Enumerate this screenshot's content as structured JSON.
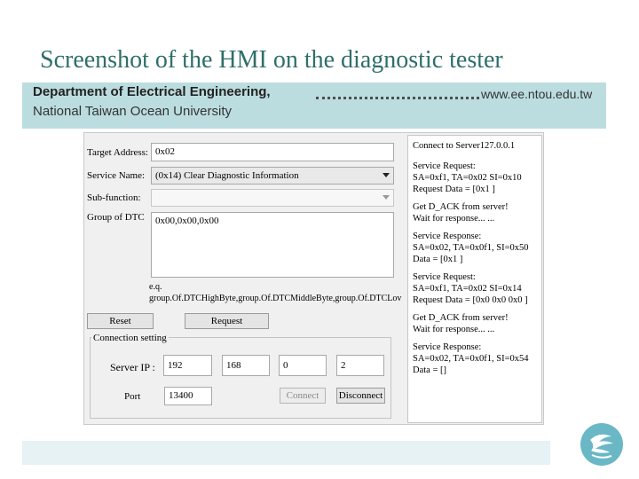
{
  "slide": {
    "title": "Screenshot of the HMI on the diagnostic tester",
    "department": "Department of Electrical Engineering,",
    "url": "www.ee.ntou.edu.tw",
    "university": "National Taiwan Ocean University"
  },
  "form": {
    "target_address_label": "Target Address:",
    "target_address_value": "0x02",
    "service_name_label": "Service Name:",
    "service_name_value": "(0x14) Clear Diagnostic Information",
    "sub_function_label": "Sub-function:",
    "sub_function_value": "",
    "group_of_dtc_label": "Group of DTC",
    "group_of_dtc_value": "0x00,0x00,0x00",
    "hint_line1": "e.q.",
    "hint_line2": "group.Of.DTCHighByte,group.Of.DTCMiddleByte,group.Of.DTCLov",
    "reset_label": "Reset",
    "request_label": "Request"
  },
  "connection": {
    "group_label": "Connection setting",
    "server_ip_label": "Server IP :",
    "ip_octets": [
      "192",
      "168",
      "0",
      "2"
    ],
    "port_label": "Port",
    "port_value": "13400",
    "connect_label": "Connect",
    "disconnect_label": "Disconnect"
  },
  "log": [
    [
      "Connect to Server127.0.0.1"
    ],
    [
      "Service Request:",
      "SA=0xf1,  TA=0x02 SI=0x10",
      "Request Data = [0x1 ]"
    ],
    [
      "Get D_ACK from server!",
      "Wait for response... ..."
    ],
    [
      "Service Response:",
      "SA=0x02,  TA=0x0f1, SI=0x50",
      "Data = [0x1 ]"
    ],
    [
      "Service Request:",
      "SA=0xf1,  TA=0x02 SI=0x14",
      "Request Data = [0x0 0x0 0x0 ]"
    ],
    [
      "Get D_ACK from server!",
      "Wait for response... ..."
    ],
    [
      "Service Response:",
      "SA=0x02,  TA=0x0f1, SI=0x54",
      "Data = []"
    ]
  ],
  "colors": {
    "title": "#2e6f6a",
    "header_band": "#bcdde0",
    "bottom_band": "#e6f2f4",
    "logo": "#6ab7c6"
  },
  "icons": {
    "logo": "university-logo-icon"
  }
}
